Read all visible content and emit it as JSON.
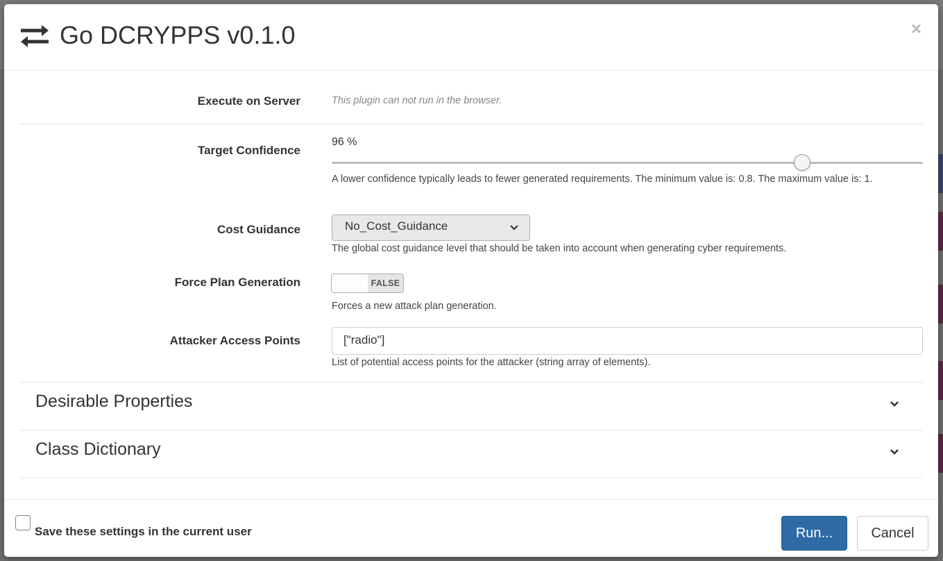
{
  "colors": {
    "primary": "#2e6ba6",
    "overlay": "#6f6f6f"
  },
  "header": {
    "title": "Go DCRYPPS v0.1.0",
    "icon": "exchange-arrows-icon",
    "close_label": "×"
  },
  "fields": {
    "execute_on_server": {
      "label": "Execute on Server",
      "note": "This plugin can not run in the browser."
    },
    "target_confidence": {
      "label": "Target Confidence",
      "display": "96 %",
      "value": 0.96,
      "min": 0.8,
      "max": 1,
      "hint": "A lower confidence typically leads to fewer generated requirements. The minimum value is: 0.8. The maximum value is: 1."
    },
    "cost_guidance": {
      "label": "Cost Guidance",
      "selected": "No_Cost_Guidance",
      "hint": "The global cost guidance level that should be taken into account when generating cyber requirements."
    },
    "force_plan_generation": {
      "label": "Force Plan Generation",
      "state": "FALSE",
      "hint": "Forces a new attack plan generation."
    },
    "attacker_access_points": {
      "label": "Attacker Access Points",
      "value": "[\"radio\"]",
      "hint": "List of potential access points for the attacker (string array of elements)."
    }
  },
  "sections": [
    {
      "title": "Desirable Properties"
    },
    {
      "title": "Class Dictionary"
    }
  ],
  "footer": {
    "save_settings_label": "Save these settings in the current user",
    "save_settings_checked": false,
    "run_label": "Run...",
    "cancel_label": "Cancel"
  }
}
